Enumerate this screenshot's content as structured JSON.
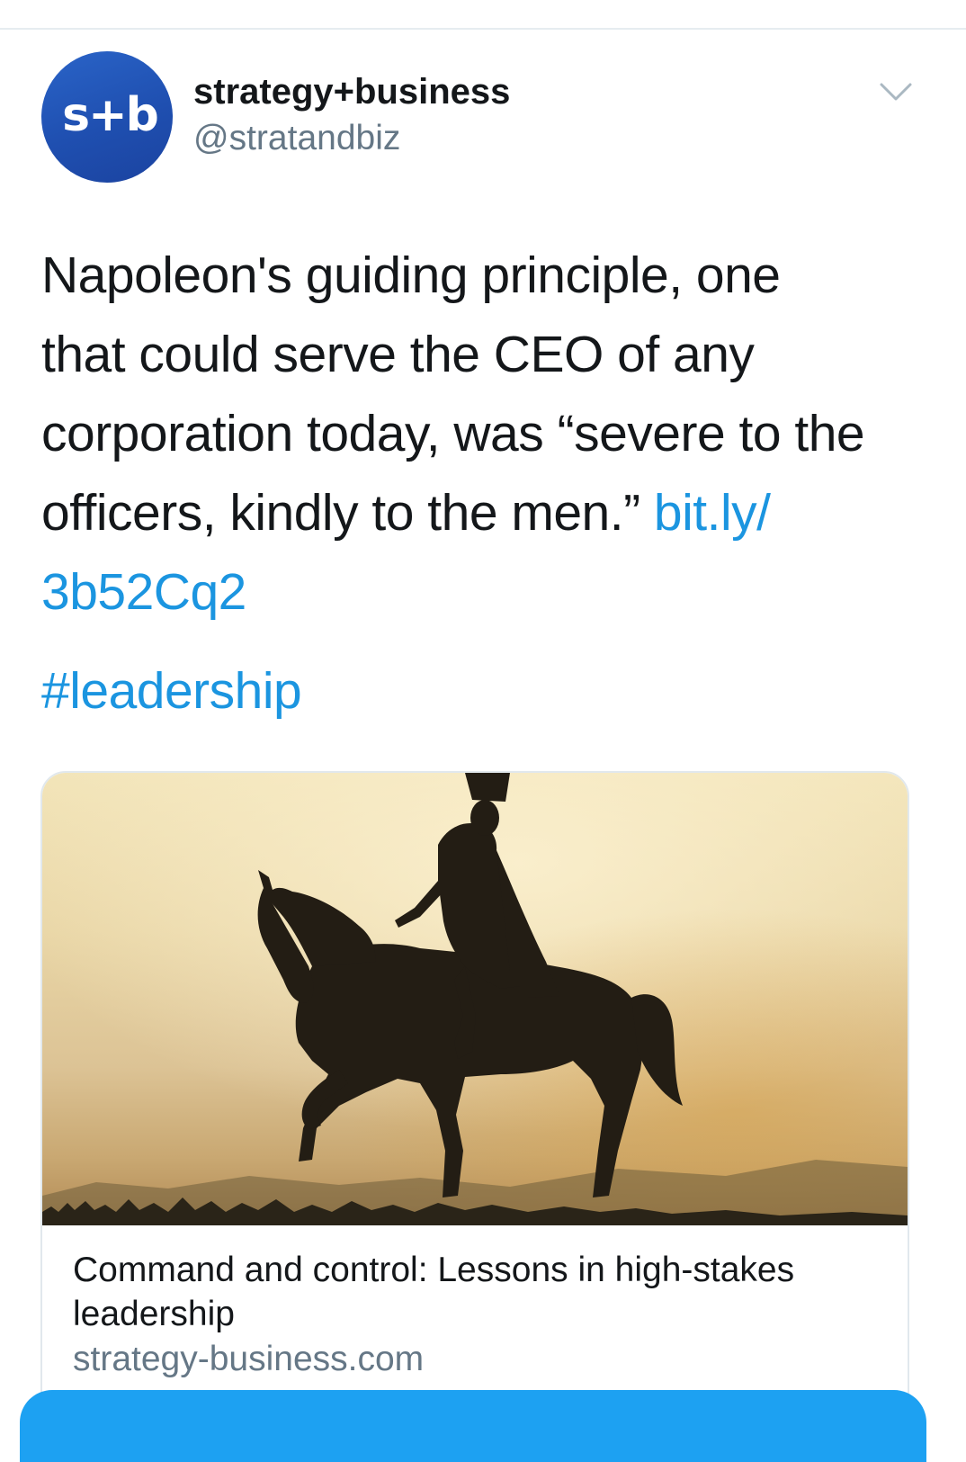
{
  "author": {
    "avatar_text": "s+b",
    "display_name": "strategy+business",
    "handle": "@stratandbiz"
  },
  "tweet": {
    "text_line_1": "Napoleon's guiding principle, one",
    "text_line_2": "that could serve the CEO of any",
    "text_line_3": "corporation today, was “severe to the",
    "text_line_4": "officers, kindly to the men.”",
    "link_part_1": "bit.ly/",
    "link_part_2": "3b52Cq2",
    "hashtag": "#leadership"
  },
  "card": {
    "title": "Command and control: Lessons in high-stakes leadership",
    "domain": "strategy-business.com",
    "image_icon": "napoleon-equestrian-statue-silhouette"
  },
  "colors": {
    "link": "#1b95e0",
    "avatar_blue": "#1f4fb0",
    "muted_text": "#657786",
    "button_blue": "#1da1f2"
  },
  "icons": {
    "menu": "chevron-down-icon"
  }
}
